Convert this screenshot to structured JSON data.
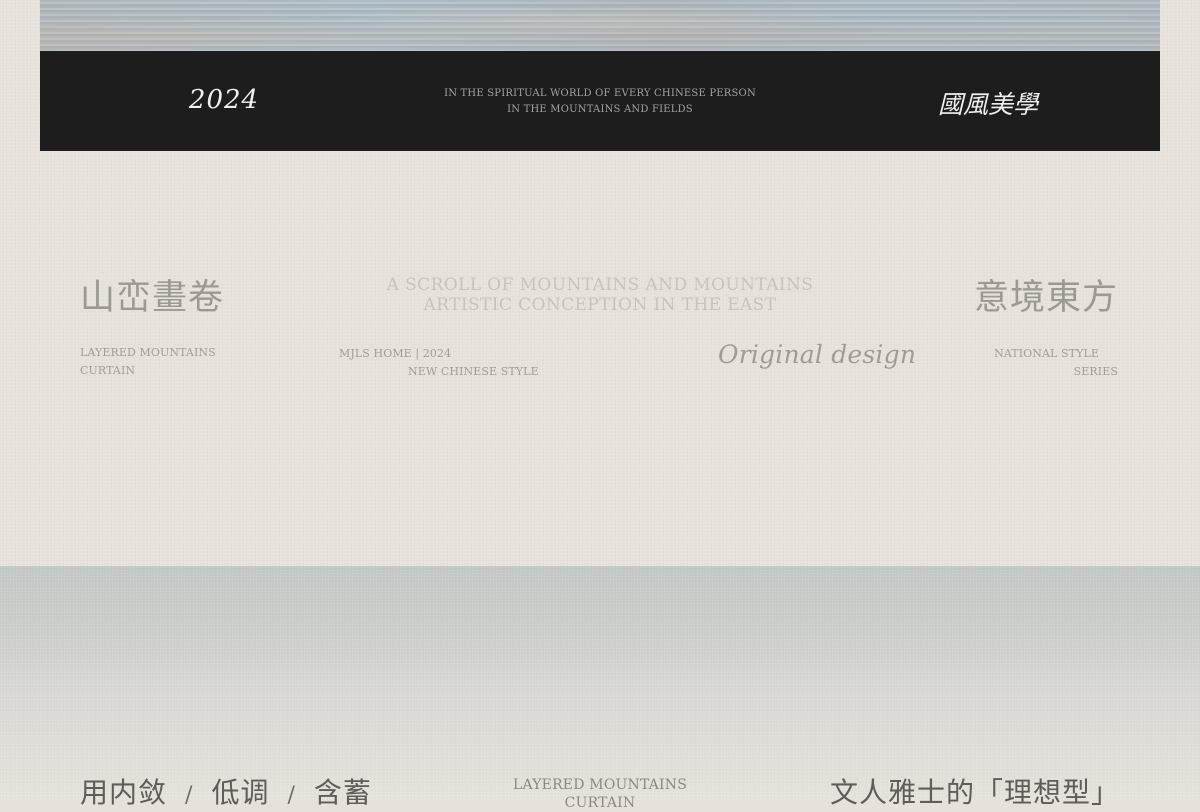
{
  "banner": {
    "year": "2024",
    "line_1": "IN THE SPIRITUAL WORLD OF EVERY CHINESE PERSON",
    "line_2": "IN THE MOUNTAINS AND FIELDS",
    "right_text": "國風美學"
  },
  "section": {
    "left_title": "山峦畫卷",
    "center_line_1": "A SCROLL OF MOUNTAINS AND MOUNTAINS",
    "center_line_2": "ARTISTIC CONCEPTION IN THE EAST",
    "right_title": "意境東方",
    "left_small_1": "LAYERED MOUNTAINS",
    "left_small_2": "CURTAIN",
    "meta_1": "MJLS HOME | 2024",
    "meta_2": "NEW CHINESE STYLE",
    "original_design": "Original design",
    "right_small_1": "NATIONAL STYLE",
    "right_small_2": "SERIES"
  },
  "lower": {
    "left_1": "用内敛",
    "separator_1": "/",
    "left_2": "低调",
    "separator_2": "/",
    "left_3": "含蓄",
    "center_1": "LAYERED MOUNTAINS",
    "center_2": "CURTAIN",
    "right_text": "文人雅士的「理想型」"
  }
}
